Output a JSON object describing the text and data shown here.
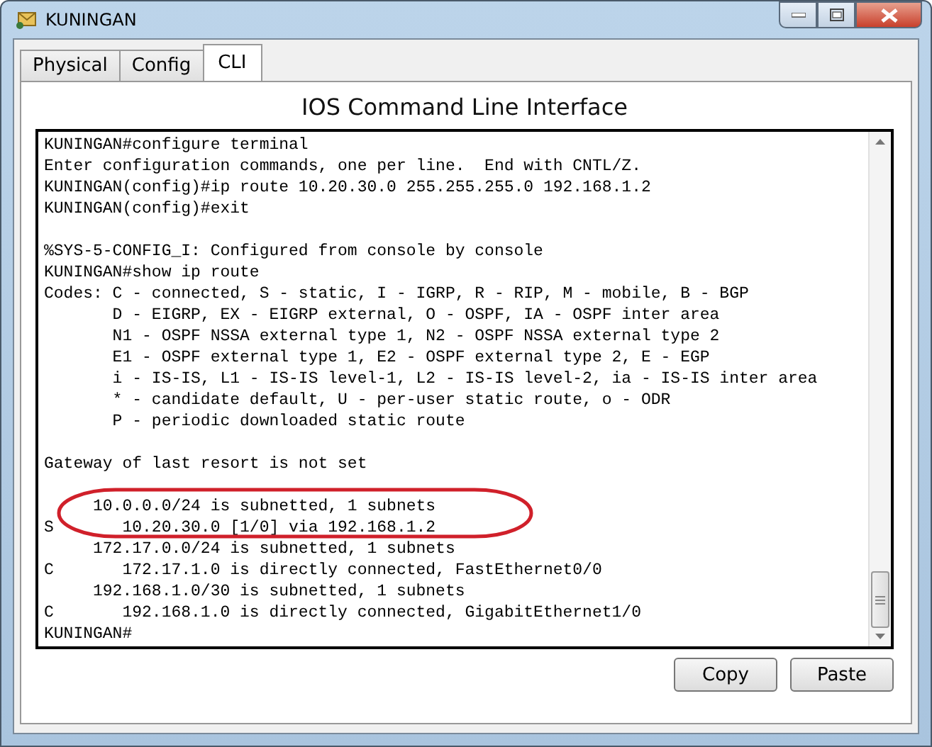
{
  "window": {
    "title": "KUNINGAN"
  },
  "tabs": [
    {
      "label": "Physical",
      "selected": false
    },
    {
      "label": "Config",
      "selected": false
    },
    {
      "label": "CLI",
      "selected": true
    }
  ],
  "heading": "IOS Command Line Interface",
  "terminal": {
    "blocks": [
      [
        "KUNINGAN#configure terminal",
        "Enter configuration commands, one per line.  End with CNTL/Z.",
        "KUNINGAN(config)#ip route 10.20.30.0 255.255.255.0 192.168.1.2",
        "KUNINGAN(config)#exit"
      ],
      [
        "%SYS-5-CONFIG_I: Configured from console by console",
        "KUNINGAN#show ip route",
        "Codes: C - connected, S - static, I - IGRP, R - RIP, M - mobile, B - BGP",
        "       D - EIGRP, EX - EIGRP external, O - OSPF, IA - OSPF inter area",
        "       N1 - OSPF NSSA external type 1, N2 - OSPF NSSA external type 2",
        "       E1 - OSPF external type 1, E2 - OSPF external type 2, E - EGP",
        "       i - IS-IS, L1 - IS-IS level-1, L2 - IS-IS level-2, ia - IS-IS inter area",
        "       * - candidate default, U - per-user static route, o - ODR",
        "       P - periodic downloaded static route"
      ],
      [
        "Gateway of last resort is not set"
      ],
      [
        "     10.0.0.0/24 is subnetted, 1 subnets",
        "S       10.20.30.0 [1/0] via 192.168.1.2",
        "     172.17.0.0/24 is subnetted, 1 subnets",
        "C       172.17.1.0 is directly connected, FastEthernet0/0",
        "     192.168.1.0/30 is subnetted, 1 subnets",
        "C       192.168.1.0 is directly connected, GigabitEthernet1/0",
        "KUNINGAN#"
      ]
    ]
  },
  "buttons": [
    "Copy",
    "Paste"
  ]
}
